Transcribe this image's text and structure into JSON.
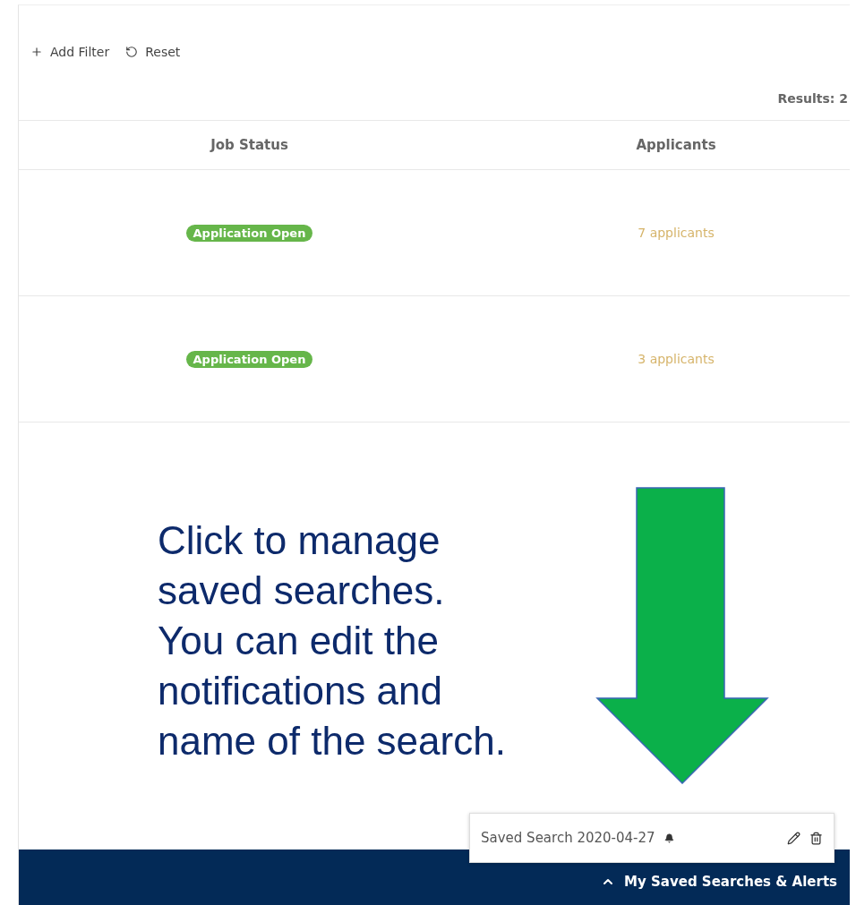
{
  "toolbar": [
    {
      "kind": "add",
      "label": "Add Filter"
    },
    {
      "kind": "reset",
      "label": "Reset"
    }
  ],
  "results": "Results: 2",
  "table": {
    "columns": [
      "Job Status",
      "Applicants"
    ],
    "rows": [
      {
        "status": "Application Open",
        "applicants": "7 applicants"
      },
      {
        "status": "Application Open",
        "applicants": "3 applicants"
      }
    ]
  },
  "annotation": [
    "Click to manage",
    "saved searches.",
    "You can edit the",
    "notifications and",
    "name of the search."
  ],
  "saved_search_popup": {
    "name": "Saved Search 2020-04-27"
  },
  "footer": {
    "label": "My Saved Searches & Alerts"
  }
}
